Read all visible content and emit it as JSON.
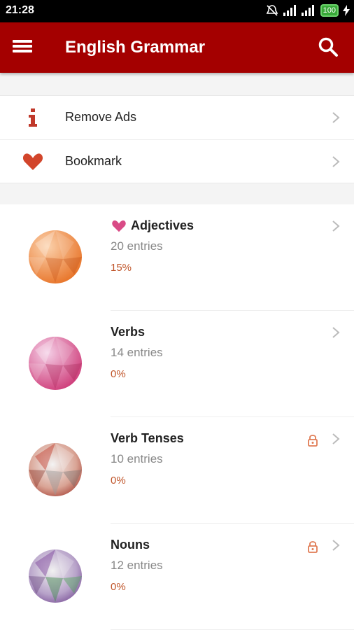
{
  "status_bar": {
    "time": "21:28",
    "battery": "100"
  },
  "app_bar": {
    "title": "English Grammar"
  },
  "menu": [
    {
      "label": "Remove Ads",
      "icon": "info-icon"
    },
    {
      "label": "Bookmark",
      "icon": "heart-icon"
    }
  ],
  "lessons": [
    {
      "name": "Adjectives",
      "entries": "20 entries",
      "progress": "15%",
      "bookmarked": true,
      "locked": false,
      "colors": [
        "#f7a96a",
        "#e8752a"
      ]
    },
    {
      "name": "Verbs",
      "entries": "14 entries",
      "progress": "0%",
      "bookmarked": false,
      "locked": false,
      "colors": [
        "#e9a3cf",
        "#cf3f7b"
      ]
    },
    {
      "name": "Verb Tenses",
      "entries": "10 entries",
      "progress": "0%",
      "bookmarked": false,
      "locked": true,
      "colors": [
        "#f0c2b0",
        "#b83a2a"
      ]
    },
    {
      "name": "Nouns",
      "entries": "12 entries",
      "progress": "0%",
      "bookmarked": false,
      "locked": true,
      "colors": [
        "#c7b0d8",
        "#5aa060"
      ]
    }
  ],
  "colors": {
    "accent": "#a40000",
    "progress_text": "#c0552a",
    "bookmark_heart": "#d94b86"
  }
}
